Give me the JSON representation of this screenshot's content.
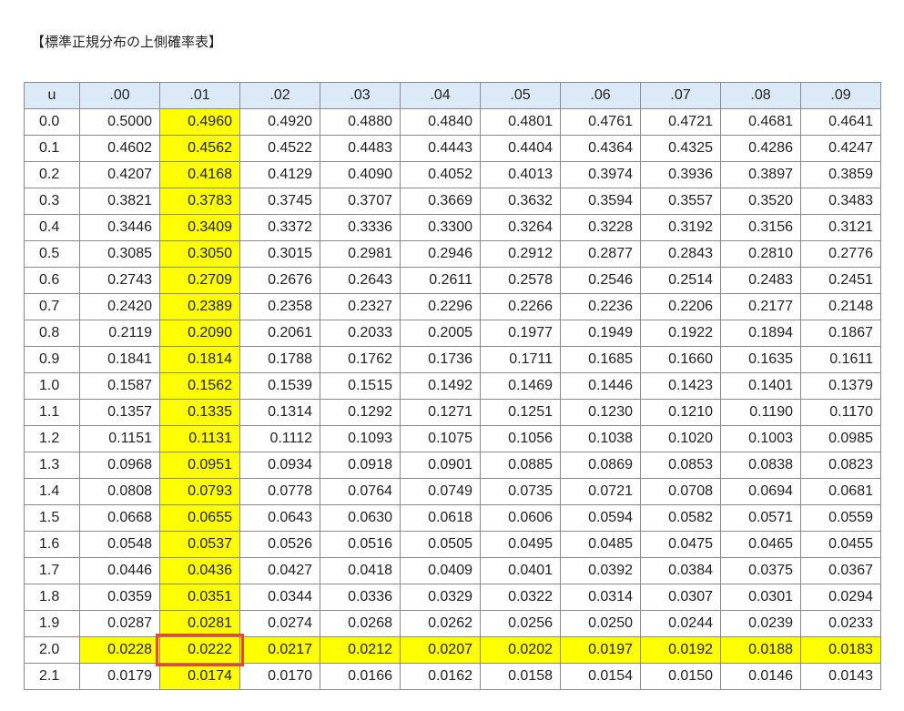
{
  "title": "【標準正規分布の上側確率表】",
  "table": {
    "headers": [
      "u",
      ".00",
      ".01",
      ".02",
      ".03",
      ".04",
      ".05",
      ".06",
      ".07",
      ".08",
      ".09"
    ],
    "highlight_column": ".01",
    "highlight_row": "2.0",
    "target_cell": {
      "row": "2.0",
      "column": ".01",
      "value": "0.0222"
    },
    "highlight_color": "#ffff00",
    "header_bg": "#dce9f7",
    "target_border_color": "#e8492b",
    "rows": [
      {
        "u": "0.0",
        "values": [
          "0.5000",
          "0.4960",
          "0.4920",
          "0.4880",
          "0.4840",
          "0.4801",
          "0.4761",
          "0.4721",
          "0.4681",
          "0.4641"
        ]
      },
      {
        "u": "0.1",
        "values": [
          "0.4602",
          "0.4562",
          "0.4522",
          "0.4483",
          "0.4443",
          "0.4404",
          "0.4364",
          "0.4325",
          "0.4286",
          "0.4247"
        ]
      },
      {
        "u": "0.2",
        "values": [
          "0.4207",
          "0.4168",
          "0.4129",
          "0.4090",
          "0.4052",
          "0.4013",
          "0.3974",
          "0.3936",
          "0.3897",
          "0.3859"
        ]
      },
      {
        "u": "0.3",
        "values": [
          "0.3821",
          "0.3783",
          "0.3745",
          "0.3707",
          "0.3669",
          "0.3632",
          "0.3594",
          "0.3557",
          "0.3520",
          "0.3483"
        ]
      },
      {
        "u": "0.4",
        "values": [
          "0.3446",
          "0.3409",
          "0.3372",
          "0.3336",
          "0.3300",
          "0.3264",
          "0.3228",
          "0.3192",
          "0.3156",
          "0.3121"
        ]
      },
      {
        "u": "0.5",
        "values": [
          "0.3085",
          "0.3050",
          "0.3015",
          "0.2981",
          "0.2946",
          "0.2912",
          "0.2877",
          "0.2843",
          "0.2810",
          "0.2776"
        ]
      },
      {
        "u": "0.6",
        "values": [
          "0.2743",
          "0.2709",
          "0.2676",
          "0.2643",
          "0.2611",
          "0.2578",
          "0.2546",
          "0.2514",
          "0.2483",
          "0.2451"
        ]
      },
      {
        "u": "0.7",
        "values": [
          "0.2420",
          "0.2389",
          "0.2358",
          "0.2327",
          "0.2296",
          "0.2266",
          "0.2236",
          "0.2206",
          "0.2177",
          "0.2148"
        ]
      },
      {
        "u": "0.8",
        "values": [
          "0.2119",
          "0.2090",
          "0.2061",
          "0.2033",
          "0.2005",
          "0.1977",
          "0.1949",
          "0.1922",
          "0.1894",
          "0.1867"
        ]
      },
      {
        "u": "0.9",
        "values": [
          "0.1841",
          "0.1814",
          "0.1788",
          "0.1762",
          "0.1736",
          "0.1711",
          "0.1685",
          "0.1660",
          "0.1635",
          "0.1611"
        ]
      },
      {
        "u": "1.0",
        "values": [
          "0.1587",
          "0.1562",
          "0.1539",
          "0.1515",
          "0.1492",
          "0.1469",
          "0.1446",
          "0.1423",
          "0.1401",
          "0.1379"
        ]
      },
      {
        "u": "1.1",
        "values": [
          "0.1357",
          "0.1335",
          "0.1314",
          "0.1292",
          "0.1271",
          "0.1251",
          "0.1230",
          "0.1210",
          "0.1190",
          "0.1170"
        ]
      },
      {
        "u": "1.2",
        "values": [
          "0.1151",
          "0.1131",
          "0.1112",
          "0.1093",
          "0.1075",
          "0.1056",
          "0.1038",
          "0.1020",
          "0.1003",
          "0.0985"
        ]
      },
      {
        "u": "1.3",
        "values": [
          "0.0968",
          "0.0951",
          "0.0934",
          "0.0918",
          "0.0901",
          "0.0885",
          "0.0869",
          "0.0853",
          "0.0838",
          "0.0823"
        ]
      },
      {
        "u": "1.4",
        "values": [
          "0.0808",
          "0.0793",
          "0.0778",
          "0.0764",
          "0.0749",
          "0.0735",
          "0.0721",
          "0.0708",
          "0.0694",
          "0.0681"
        ]
      },
      {
        "u": "1.5",
        "values": [
          "0.0668",
          "0.0655",
          "0.0643",
          "0.0630",
          "0.0618",
          "0.0606",
          "0.0594",
          "0.0582",
          "0.0571",
          "0.0559"
        ]
      },
      {
        "u": "1.6",
        "values": [
          "0.0548",
          "0.0537",
          "0.0526",
          "0.0516",
          "0.0505",
          "0.0495",
          "0.0485",
          "0.0475",
          "0.0465",
          "0.0455"
        ]
      },
      {
        "u": "1.7",
        "values": [
          "0.0446",
          "0.0436",
          "0.0427",
          "0.0418",
          "0.0409",
          "0.0401",
          "0.0392",
          "0.0384",
          "0.0375",
          "0.0367"
        ]
      },
      {
        "u": "1.8",
        "values": [
          "0.0359",
          "0.0351",
          "0.0344",
          "0.0336",
          "0.0329",
          "0.0322",
          "0.0314",
          "0.0307",
          "0.0301",
          "0.0294"
        ]
      },
      {
        "u": "1.9",
        "values": [
          "0.0287",
          "0.0281",
          "0.0274",
          "0.0268",
          "0.0262",
          "0.0256",
          "0.0250",
          "0.0244",
          "0.0239",
          "0.0233"
        ]
      },
      {
        "u": "2.0",
        "values": [
          "0.0228",
          "0.0222",
          "0.0217",
          "0.0212",
          "0.0207",
          "0.0202",
          "0.0197",
          "0.0192",
          "0.0188",
          "0.0183"
        ]
      },
      {
        "u": "2.1",
        "values": [
          "0.0179",
          "0.0174",
          "0.0170",
          "0.0166",
          "0.0162",
          "0.0158",
          "0.0154",
          "0.0150",
          "0.0146",
          "0.0143"
        ]
      }
    ]
  }
}
